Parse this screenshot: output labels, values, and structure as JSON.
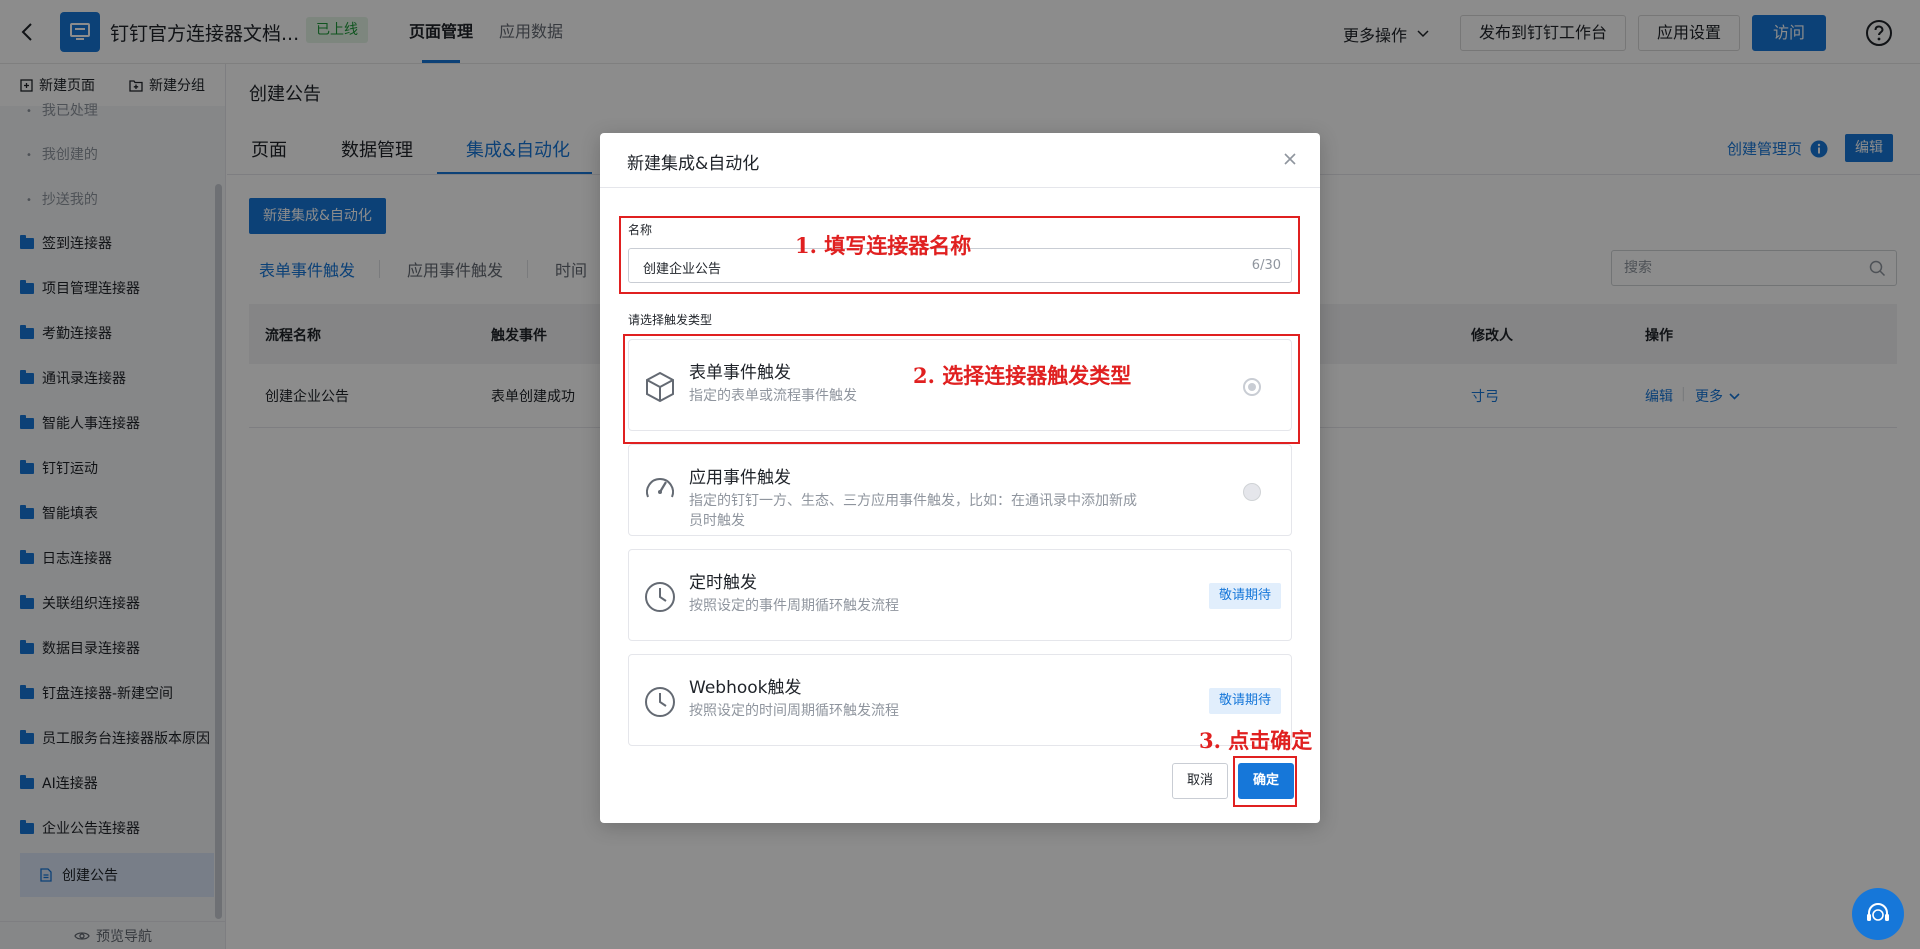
{
  "header": {
    "app_name": "钉钉官方连接器文档...",
    "status_badge": "已上线",
    "tabs": [
      {
        "label": "页面管理"
      },
      {
        "label": "应用数据"
      }
    ],
    "more_ops": "更多操作",
    "publish_btn": "发布到钉钉工作台",
    "settings_btn": "应用设置",
    "visit_btn": "访问"
  },
  "sidebar": {
    "new_page": "新建页面",
    "new_group": "新建分组",
    "sub_items": [
      {
        "label": "我已处理"
      },
      {
        "label": "我创建的"
      },
      {
        "label": "抄送我的"
      }
    ],
    "folders": [
      {
        "label": "签到连接器"
      },
      {
        "label": "项目管理连接器"
      },
      {
        "label": "考勤连接器"
      },
      {
        "label": "通讯录连接器"
      },
      {
        "label": "智能人事连接器"
      },
      {
        "label": "钉钉运动"
      },
      {
        "label": "智能填表"
      },
      {
        "label": "日志连接器"
      },
      {
        "label": "关联组织连接器"
      },
      {
        "label": "数据目录连接器"
      },
      {
        "label": "钉盘连接器-新建空间"
      },
      {
        "label": "员工服务台连接器版本原因..."
      },
      {
        "label": "AI连接器"
      },
      {
        "label": "企业公告连接器"
      }
    ],
    "active_page": "创建公告",
    "footer": "预览导航"
  },
  "main": {
    "page_title": "创建公告",
    "tabs": [
      {
        "label": "页面"
      },
      {
        "label": "数据管理"
      },
      {
        "label": "集成&自动化"
      }
    ],
    "manage_link": "创建管理页",
    "edit_btn": "编辑",
    "new_btn": "新建集成&自动化",
    "filter_tabs": [
      {
        "label": "表单事件触发"
      },
      {
        "label": "应用事件触发"
      },
      {
        "label": "时间"
      }
    ],
    "search_placeholder": "搜索",
    "table": {
      "headers": [
        "流程名称",
        "触发事件",
        "修改人",
        "操作"
      ],
      "rows": [
        {
          "name": "创建企业公告",
          "event": "表单创建成功",
          "modifier": "寸弓",
          "edit": "编辑",
          "more": "更多"
        }
      ]
    }
  },
  "modal": {
    "title": "新建集成&自动化",
    "name_label": "名称",
    "name_value": "创建企业公告",
    "name_count": "6/30",
    "trigger_label": "请选择触发类型",
    "options": [
      {
        "title": "表单事件触发",
        "desc": "指定的表单或流程事件触发",
        "icon": "cube-icon"
      },
      {
        "title": "应用事件触发",
        "desc": "指定的钉钉一方、生态、三方应用事件触发，比如：在通讯录中添加新成员时触发",
        "icon": "gauge-icon"
      },
      {
        "title": "定时触发",
        "desc": "按照设定的事件周期循环触发流程",
        "icon": "clock-icon",
        "badge": "敬请期待"
      },
      {
        "title": "Webhook触发",
        "desc": "按照设定的时间周期循环触发流程",
        "icon": "clock-icon",
        "badge": "敬请期待"
      }
    ],
    "cancel": "取消",
    "confirm": "确定"
  },
  "annotations": {
    "step1": "1. 填写连接器名称",
    "step2": "2. 选择连接器触发类型",
    "step3": "3. 点击确定"
  },
  "colors": {
    "accent": "#1677d9",
    "annotation": "#e02020",
    "badge_green": "#1e9a3a"
  }
}
